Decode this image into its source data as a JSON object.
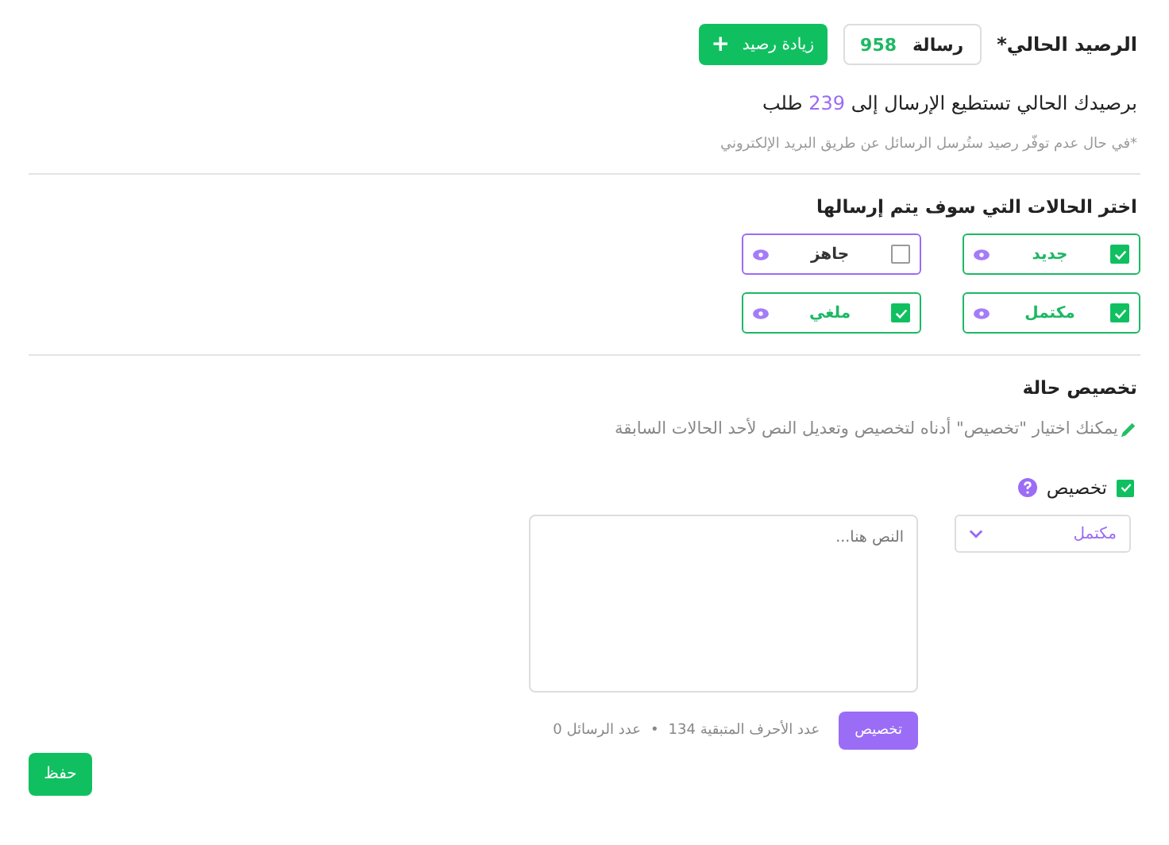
{
  "balance": {
    "label": "الرصيد الحالي*",
    "count": "958",
    "unit": "رسالة",
    "add_button": "زيادة رصيد",
    "add_icon": "+"
  },
  "capacity": {
    "prefix": "برصيدك الحالي تستطيع الإرسال إلى",
    "count": "239",
    "suffix": "طلب"
  },
  "note": "*في حال عدم توفّر رصيد ستُرسل الرسائل عن طريق البريد الإلكتروني",
  "statuses_title": "اختر الحالات التي سوف يتم إرسالها",
  "statuses": [
    {
      "label": "جديد",
      "checked": true
    },
    {
      "label": "جاهز",
      "checked": false
    },
    {
      "label": "مكتمل",
      "checked": true
    },
    {
      "label": "ملغي",
      "checked": true
    }
  ],
  "customize": {
    "title": "تخصيص حالة",
    "hint": "يمكنك اختيار \"تخصيص\" أدناه لتخصيص وتعديل النص لأحد الحالات السابقة",
    "checkbox_label": "تخصيص",
    "checked": true,
    "status_select": "مكتمل",
    "text_placeholder": "النص هنا...",
    "apply_button": "تخصيص",
    "remaining": "عدد الأحرف المتبقية 134",
    "separator": "•",
    "messages": "عدد الرسائل 0"
  },
  "save_button": "حفظ"
}
